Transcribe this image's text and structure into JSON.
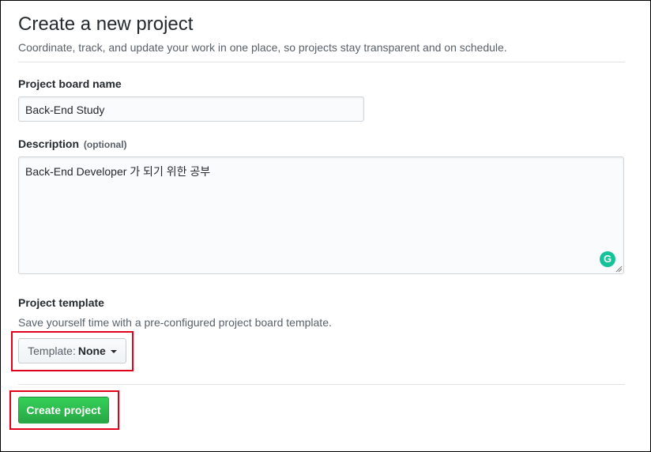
{
  "page": {
    "title": "Create a new project",
    "subtitle": "Coordinate, track, and update your work in one place, so projects stay transparent and on schedule."
  },
  "form": {
    "name_label": "Project board name",
    "name_value": "Back-End Study",
    "description_label": "Description",
    "description_optional": "(optional)",
    "description_value": "Back-End Developer 가 되기 위한 공부",
    "grammarly_letter": "G",
    "template_label": "Project template",
    "template_helper": "Save yourself time with a pre-configured project board template.",
    "template_prefix": "Template:",
    "template_value": "None",
    "submit_label": "Create project"
  },
  "colors": {
    "primary_button": "#28a745",
    "highlight_outline": "#e3001b",
    "grammarly": "#15c39a"
  },
  "icons": {
    "template_caret": "caret-down-icon",
    "grammarly": "grammarly-icon",
    "resize": "resize-handle-icon"
  }
}
